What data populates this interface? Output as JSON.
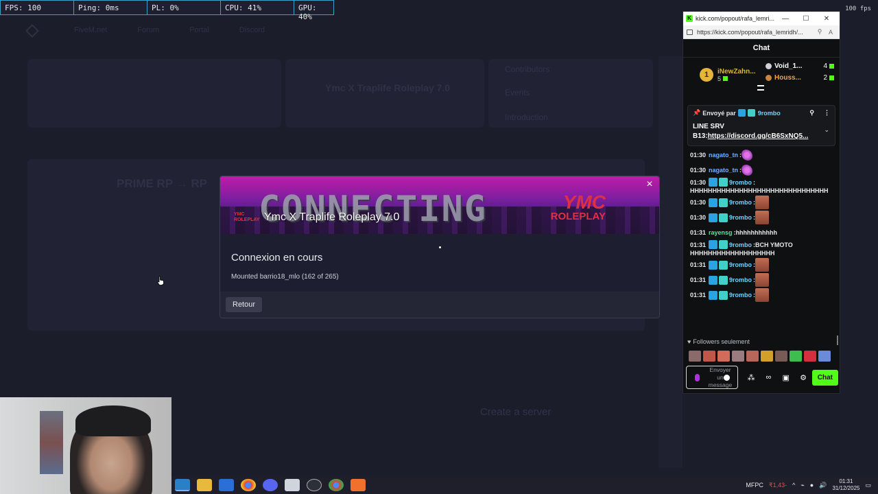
{
  "perf": {
    "fps": "FPS: 100",
    "ping": "Ping: 0ms",
    "pl": "PL: 0%",
    "cpu": "CPU: 41%",
    "gpu": "GPU: 40%",
    "corner_fps": "100 fps"
  },
  "background": {
    "nav": [
      "FiveM.net",
      "Forum",
      "Portal",
      "Discord"
    ],
    "featured_server": "Ymc X Traplife Roleplay 7.0",
    "prime_server": "PRIME RP → RP",
    "create_server_title": "Create a server",
    "sidebar_links": [
      "Contributors",
      "Events",
      "Introduction"
    ]
  },
  "modal": {
    "banner_word": "CONNECTING",
    "server_name": "Ymc X Traplife Roleplay 7.0",
    "logo_text": "YMC ROLEPLAY",
    "ymc": "YMC",
    "roleplay": "ROLEPLAY",
    "title": "Connexion en cours",
    "status": "Mounted barrio18_mlo (162 of 265)",
    "back_button": "Retour",
    "close_icon": "close-icon"
  },
  "popout": {
    "window_title": "kick.com/popout/rafa_lemri...",
    "url": "https://kick.com/popout/rafa_lemridh/...",
    "chat_header": "Chat",
    "leaderboard": {
      "first": {
        "rank": "1",
        "name": "iNewZahn...",
        "score": "5"
      },
      "others": [
        {
          "name": "Void_1...",
          "score": "4",
          "color": "#ffffff"
        },
        {
          "name": "Houss...",
          "score": "2",
          "color": "#f0a64b"
        }
      ]
    },
    "pinned": {
      "sent_by_label": "Envoyé par",
      "author": "9rombo",
      "message_prefix": "LINE SRV B13:",
      "link": "https://discord.gg/cB6SxNQ5..."
    },
    "messages": [
      {
        "time": "01:30",
        "user": "nagato_tn",
        "color": "#6fb1ff",
        "badges": false,
        "emote": "butterfly",
        "text": ""
      },
      {
        "time": "01:30",
        "user": "nagato_tn",
        "color": "#6fb1ff",
        "badges": false,
        "emote": "butterfly",
        "text": ""
      },
      {
        "time": "01:30",
        "user": "9rombo",
        "color": "#6fd4ff",
        "badges": true,
        "emote": "",
        "text": "",
        "long": "HHHHHHHHHHHHHHHHHHHHHHHHHHHHHHH"
      },
      {
        "time": "01:30",
        "user": "9rombo",
        "color": "#6fd4ff",
        "badges": true,
        "emote": "face",
        "text": ""
      },
      {
        "time": "01:30",
        "user": "9rombo",
        "color": "#6fd4ff",
        "badges": true,
        "emote": "face",
        "text": ""
      },
      {
        "time": "01:31",
        "user": "rayensg",
        "color": "#53e6a0",
        "badges": false,
        "emote": "",
        "text": "hhhhhhhhhhh"
      },
      {
        "time": "01:31",
        "user": "9rombo",
        "color": "#6fd4ff",
        "badges": true,
        "emote": "",
        "text": "BCH YMOTO",
        "long": "HHHHHHHHHHHHHHHHHHH"
      },
      {
        "time": "01:31",
        "user": "9rombo",
        "color": "#6fd4ff",
        "badges": true,
        "emote": "face",
        "text": ""
      },
      {
        "time": "01:31",
        "user": "9rombo",
        "color": "#6fd4ff",
        "badges": true,
        "emote": "face",
        "text": ""
      },
      {
        "time": "01:31",
        "user": "9rombo",
        "color": "#6fd4ff",
        "badges": true,
        "emote": "face",
        "text": ""
      }
    ],
    "followers_only": "Followers seulement",
    "input_placeholder": "Envoyer un message",
    "chat_button": "Chat"
  },
  "taskbar": {
    "apps": [
      "edge-icon",
      "file-explorer-icon",
      "mail-icon",
      "chrome-icon",
      "discord-icon",
      "app-icon",
      "obs-icon",
      "chrome-icon",
      "app-icon"
    ],
    "tray_label": "MFPC",
    "tray_value": "₹1,43-",
    "time": "01:31",
    "date": "31/12/2025"
  }
}
